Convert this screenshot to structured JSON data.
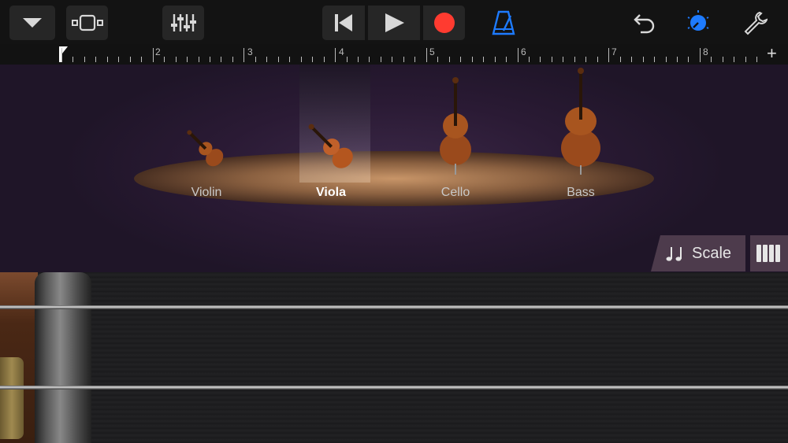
{
  "toolbar": {
    "icons": [
      "dropdown-icon",
      "tracks-view-icon",
      "mixer-icon",
      "rewind-icon",
      "play-icon",
      "record-icon",
      "metronome-icon",
      "undo-icon",
      "master-volume-icon",
      "settings-wrench-icon"
    ],
    "colors": {
      "record": "#ff3b30",
      "accent": "#1e7bff"
    }
  },
  "ruler": {
    "bars": [
      "2",
      "3",
      "4",
      "5",
      "6",
      "7",
      "8"
    ],
    "add_label": "+"
  },
  "instruments": [
    {
      "label": "Violin",
      "selected": false
    },
    {
      "label": "Viola",
      "selected": true
    },
    {
      "label": "Cello",
      "selected": false
    },
    {
      "label": "Bass",
      "selected": false
    }
  ],
  "controls": {
    "scale_label": "Scale",
    "scale_icon": "music-notes-icon",
    "keys_icon": "keyboard-icon"
  }
}
